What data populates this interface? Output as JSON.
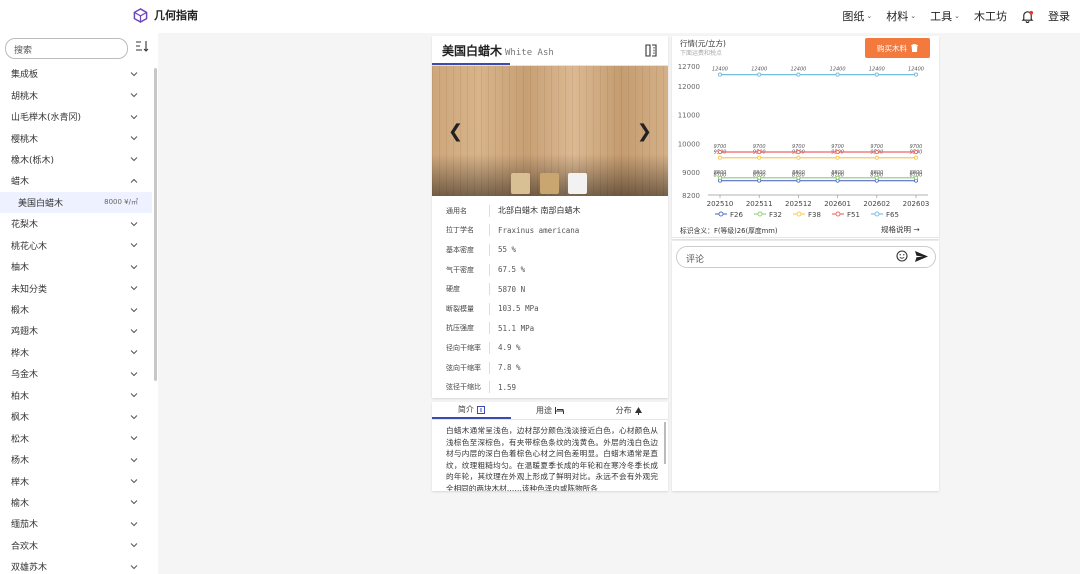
{
  "header": {
    "brand": "几何指南",
    "nav": [
      {
        "label": "图纸",
        "has_menu": true
      },
      {
        "label": "材料",
        "has_menu": true
      },
      {
        "label": "工具",
        "has_menu": true
      },
      {
        "label": "木工坊",
        "has_menu": false
      }
    ],
    "login": "登录",
    "accent": "#6b46c1",
    "notify_dot": "#e53935"
  },
  "sidebar": {
    "search_placeholder": "搜索",
    "items": [
      {
        "label": "集成板",
        "expanded": false
      },
      {
        "label": "胡桃木",
        "expanded": false
      },
      {
        "label": "山毛榉木(水青冈)",
        "expanded": false
      },
      {
        "label": "樱桃木",
        "expanded": false
      },
      {
        "label": "橡木(栎木)",
        "expanded": false
      },
      {
        "label": "蜡木",
        "expanded": true
      },
      {
        "label": "美国白蜡木",
        "sub": true,
        "price": "8000 ¥/㎥"
      },
      {
        "label": "花梨木",
        "expanded": false
      },
      {
        "label": "桃花心木",
        "expanded": false
      },
      {
        "label": "柚木",
        "expanded": false
      },
      {
        "label": "未知分类",
        "expanded": false
      },
      {
        "label": "椴木",
        "expanded": false
      },
      {
        "label": "鸡翅木",
        "expanded": false
      },
      {
        "label": "桦木",
        "expanded": false
      },
      {
        "label": "乌金木",
        "expanded": false
      },
      {
        "label": "柏木",
        "expanded": false
      },
      {
        "label": "枫木",
        "expanded": false
      },
      {
        "label": "松木",
        "expanded": false
      },
      {
        "label": "杨木",
        "expanded": false
      },
      {
        "label": "榉木",
        "expanded": false
      },
      {
        "label": "榆木",
        "expanded": false
      },
      {
        "label": "缅茄木",
        "expanded": false
      },
      {
        "label": "合欢木",
        "expanded": false
      },
      {
        "label": "双雄苏木",
        "expanded": false
      }
    ]
  },
  "detail": {
    "title": "美国白蜡木",
    "latin": "White Ash",
    "thumbnails": [
      "#d9bf94",
      "#c9a66f",
      "#f2f2f2"
    ],
    "props": [
      {
        "k": "通用名",
        "v": "北部白蜡木  南部白蜡木",
        "cn": true
      },
      {
        "k": "拉丁学名",
        "v": "Fraxinus americana"
      },
      {
        "k": "基本密度",
        "v": "55  %"
      },
      {
        "k": "气干密度",
        "v": "67.5  %"
      },
      {
        "k": "硬度",
        "v": "5870  N"
      },
      {
        "k": "断裂模量",
        "v": "103.5  MPa"
      },
      {
        "k": "抗压强度",
        "v": "51.1  MPa"
      },
      {
        "k": "径向干缩率",
        "v": "4.9  %"
      },
      {
        "k": "弦向干缩率",
        "v": "7.8  %"
      },
      {
        "k": "弦径干缩比",
        "v": "1.59"
      }
    ]
  },
  "intro": {
    "tabs": [
      {
        "label": "简介",
        "active": true
      },
      {
        "label": "用途",
        "active": false
      },
      {
        "label": "分布",
        "active": false
      }
    ],
    "text": "白蜡木通常呈浅色，边材部分颜色浅淡接近白色，心材颜色从浅棕色至深棕色，有夹带棕色条纹的浅黄色。外层的浅白色边材与内层的深白色着棕色心材之间色差明显。白蜡木通常是直纹，纹理粗糙均匀。在温暖夏季长成的年轮和在寒冷冬季长成的年轮，其纹理在外观上形成了鲜明对比。永远不会有外观完全相同的两块木材……该种色泽内或陈物所各"
  },
  "price": {
    "title": "行情(元/立方)",
    "subtitle": "下面运费和税点",
    "buy_label": "购买木料",
    "legend_note": "标识含义：F(等级)26(厚度mm)",
    "spec_label": "规格说明"
  },
  "chart_data": {
    "type": "line",
    "x": [
      "202510",
      "202511",
      "202512",
      "202601",
      "202602",
      "202603"
    ],
    "ylim": [
      8200,
      12700
    ],
    "yticks": [
      8200,
      9000,
      10000,
      11000,
      12000,
      12700
    ],
    "series": [
      {
        "name": "F26",
        "color": "#5470c6",
        "values": [
          8700,
          8700,
          8700,
          8700,
          8700,
          8700
        ]
      },
      {
        "name": "F32",
        "color": "#91cc75",
        "values": [
          8800,
          8800,
          8800,
          8800,
          8800,
          8800
        ]
      },
      {
        "name": "F38",
        "color": "#fac858",
        "values": [
          9500,
          9500,
          9500,
          9500,
          9500,
          9500
        ]
      },
      {
        "name": "F51",
        "color": "#ee6666",
        "values": [
          9700,
          9700,
          9700,
          9700,
          9700,
          9700
        ]
      },
      {
        "name": "F65",
        "color": "#73c0de",
        "values": [
          12400,
          12400,
          12400,
          12400,
          12400,
          12400
        ]
      }
    ],
    "data_labels": [
      {
        "series": "F26",
        "text": "8700"
      },
      {
        "series": "F32",
        "text": "8800"
      },
      {
        "series": "F38",
        "text": "9500"
      },
      {
        "series": "F51",
        "text": "9700"
      },
      {
        "series": "F65",
        "text": "12400"
      }
    ]
  },
  "comment": {
    "placeholder": "评论"
  }
}
